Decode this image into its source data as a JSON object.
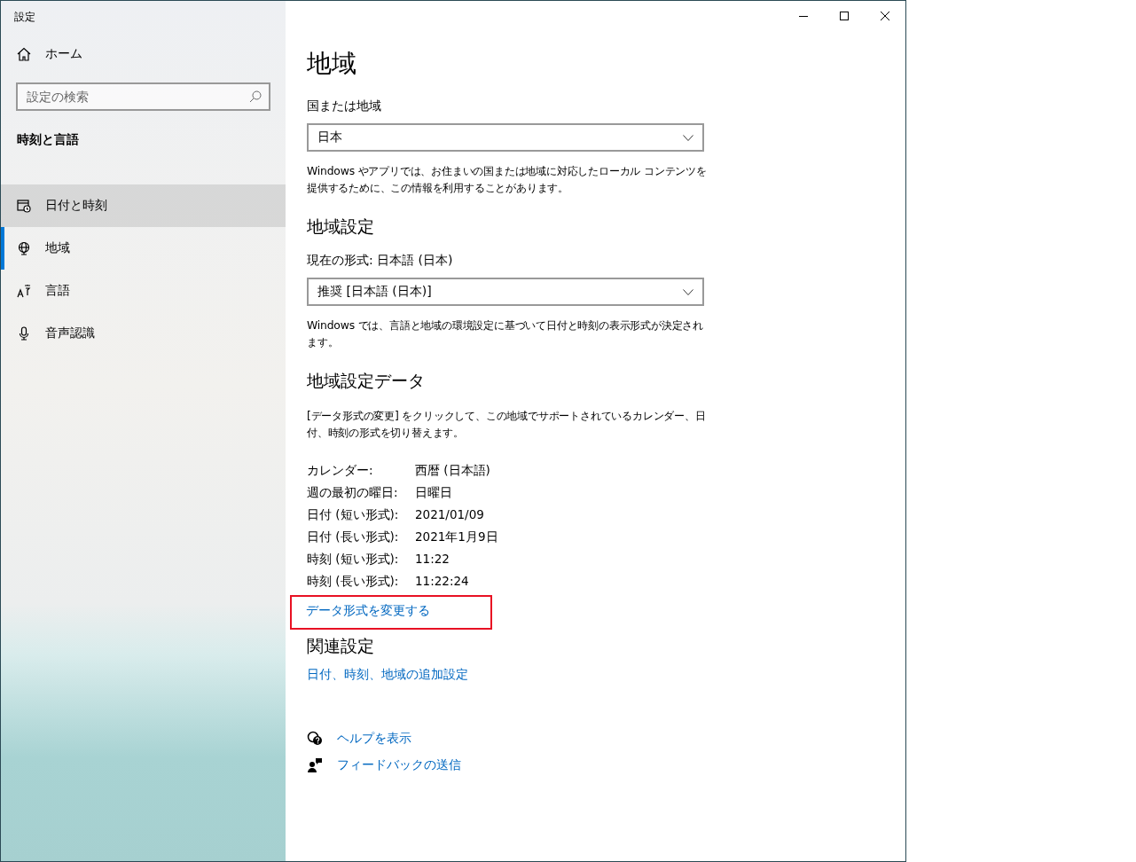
{
  "window": {
    "title": "設定"
  },
  "sidebar": {
    "home": "ホーム",
    "search": {
      "placeholder": "設定の検索"
    },
    "section": "時刻と言語",
    "items": [
      {
        "label": "日付と時刻",
        "kind": "calendar",
        "selected": false,
        "hovered": true
      },
      {
        "label": "地域",
        "kind": "globe",
        "selected": true,
        "hovered": false
      },
      {
        "label": "言語",
        "kind": "language",
        "selected": false,
        "hovered": false
      },
      {
        "label": "音声認識",
        "kind": "mic",
        "selected": false,
        "hovered": false
      }
    ]
  },
  "page": {
    "title": "地域",
    "country": {
      "label": "国または地域",
      "value": "日本",
      "description": "Windows やアプリでは、お住まいの国または地域に対応したローカル コンテンツを提供するために、この情報を利用することがあります。"
    },
    "regional_format": {
      "heading": "地域設定",
      "label": "現在の形式: 日本語 (日本)",
      "value": "推奨 [日本語 (日本)]",
      "description": "Windows では、言語と地域の環境設定に基づいて日付と時刻の表示形式が決定されます。"
    },
    "format_data": {
      "heading": "地域設定データ",
      "description": "[データ形式の変更] をクリックして、この地域でサポートされているカレンダー、日付、時刻の形式を切り替えます。",
      "rows": [
        {
          "label": "カレンダー:",
          "value": "西暦 (日本語)"
        },
        {
          "label": "週の最初の曜日:",
          "value": "日曜日"
        },
        {
          "label": "日付 (短い形式):",
          "value": "2021/01/09"
        },
        {
          "label": "日付 (長い形式):",
          "value": "2021年1月9日"
        },
        {
          "label": "時刻 (短い形式):",
          "value": "11:22"
        },
        {
          "label": "時刻 (長い形式):",
          "value": "11:22:24"
        }
      ],
      "link": {
        "label": "データ形式を変更する",
        "highlighted": true
      }
    },
    "related": {
      "heading": "関連設定",
      "link": "日付、時刻、地域の追加設定"
    },
    "help": [
      {
        "kind": "help",
        "label": "ヘルプを表示"
      },
      {
        "kind": "feedback",
        "label": "フィードバックの送信"
      }
    ]
  }
}
